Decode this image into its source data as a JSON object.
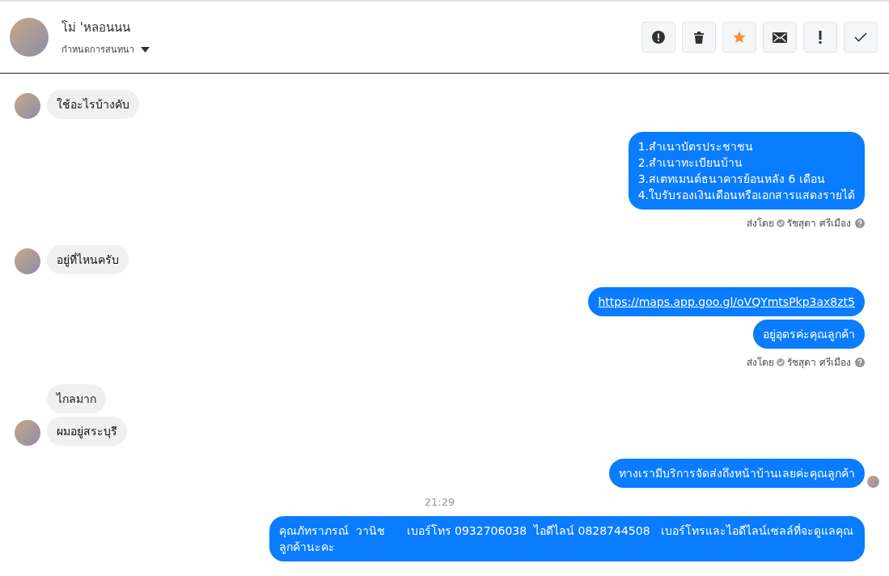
{
  "header": {
    "name": "โม่ 'หลอนนน",
    "subtitle": "กำหนดการสนทนา",
    "tools": [
      {
        "kind": "alert",
        "active": false
      },
      {
        "kind": "trash",
        "active": false
      },
      {
        "kind": "star",
        "active": true
      },
      {
        "kind": "mail",
        "active": false
      },
      {
        "kind": "exclaim",
        "active": false
      },
      {
        "kind": "check",
        "active": false
      }
    ]
  },
  "messages": [
    {
      "kind": "incoming",
      "text": "ใช้อะไรบ้างคับ",
      "avatar": true
    },
    {
      "kind": "outgoing",
      "text": "1.สำเนาบัตรประชาชน\n2.สำเนาทะเบียนบ้าน\n3.สเตทเมนต์ธนาคารย้อนหลัง 6 เดือน\n4.ใบรับรองเงินเดือนหรือเอกสารแสดงรายได้",
      "link": false,
      "seen": false
    },
    {
      "kind": "sent_by",
      "label": "ส่งโดย",
      "name": "รัชสุดา ศรีเมือง"
    },
    {
      "kind": "incoming",
      "text": "อยู่ที่ไหนครับ",
      "avatar": true
    },
    {
      "kind": "outgoing",
      "text": "https://maps.app.goo.gl/oVQYmtsPkp3ax8zt5",
      "link": true,
      "seen": false
    },
    {
      "kind": "outgoing",
      "text": "อยู่อุดรค่ะคุณลูกค้า",
      "link": false,
      "seen": false
    },
    {
      "kind": "sent_by",
      "label": "ส่งโดย",
      "name": "รัชสุดา ศรีเมือง"
    },
    {
      "kind": "incoming",
      "text": "ไกลมาก",
      "avatar": false
    },
    {
      "kind": "incoming",
      "text": "ผมอยู่สระบุรี",
      "avatar": true
    },
    {
      "kind": "outgoing",
      "text": "ทางเรามีบริการจัดส่งถึงหน้าบ้านเลยค่ะคุณลูกค้า",
      "link": false,
      "seen": true
    },
    {
      "kind": "time",
      "text": "21:29"
    },
    {
      "kind": "outgoing",
      "text": "คุณภัทราภรณ์  วานิช      เบอร์โทร 0932706038  ไอดีไลน์ 0828744508   เบอร์โทรและไอดีไลน์เซลล์ที่จะดูแลคุณลูกค้านะคะ",
      "link": false,
      "seen": false
    }
  ]
}
